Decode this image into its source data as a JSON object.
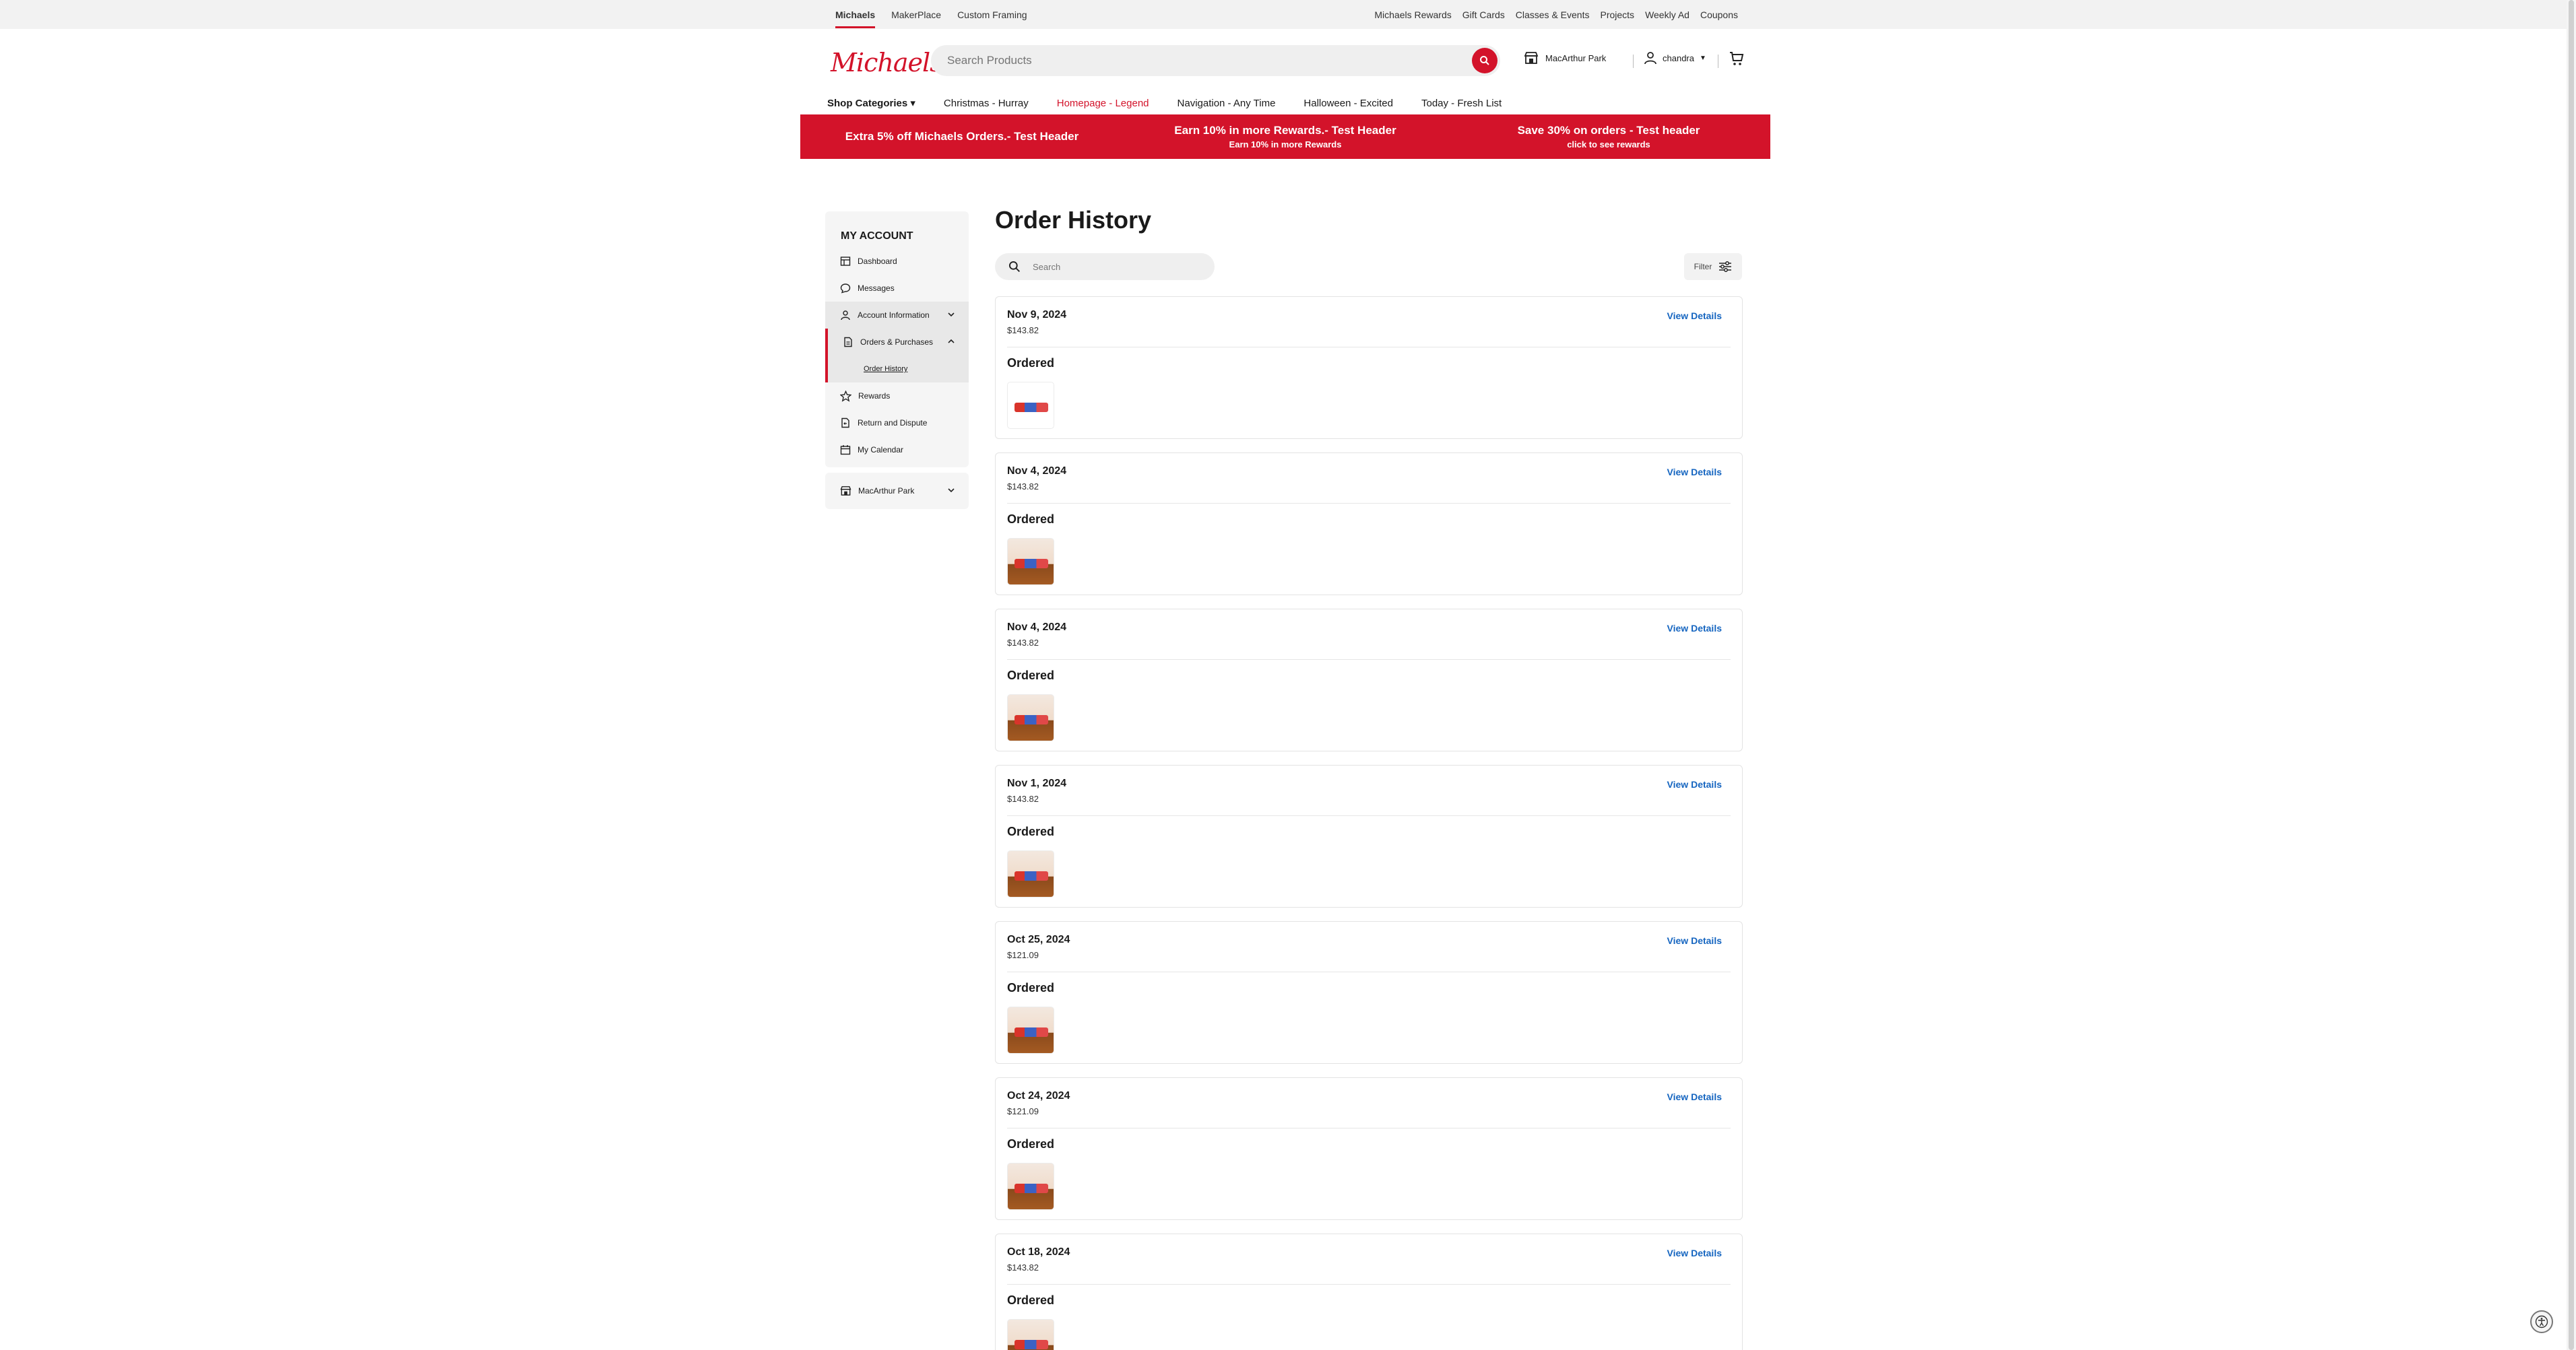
{
  "utility_bar": {
    "left": [
      "Michaels",
      "MakerPlace",
      "Custom Framing"
    ],
    "right": [
      "Michaels Rewards",
      "Gift Cards",
      "Classes & Events",
      "Projects",
      "Weekly Ad",
      "Coupons"
    ]
  },
  "header": {
    "logo": "Michaels",
    "search_placeholder": "Search Products",
    "store": "MacArthur Park",
    "user": "chandra"
  },
  "nav": [
    "Shop Categories",
    "Christmas - Hurray",
    "Homepage - Legend",
    "Navigation - Any Time",
    "Halloween - Excited",
    "Today - Fresh List"
  ],
  "promos": [
    {
      "main": "Extra 5% off Michaels Orders.- Test Header",
      "sub": ""
    },
    {
      "main": "Earn 10% in more Rewards.- Test Header",
      "sub": "Earn 10% in more Rewards"
    },
    {
      "main": "Save 30% on orders - Test header",
      "sub": "click to see rewards"
    }
  ],
  "sidebar": {
    "heading": "MY ACCOUNT",
    "items": [
      "Dashboard",
      "Messages",
      "Account Information",
      "Orders & Purchases",
      "Order History",
      "Rewards",
      "Return and Dispute",
      "My Calendar"
    ],
    "store": "MacArthur Park"
  },
  "main": {
    "title": "Order History",
    "search_placeholder": "Search",
    "filter_label": "Filter",
    "view_details_label": "View Details",
    "orders": [
      {
        "date": "Nov 9, 2024",
        "total": "$143.82",
        "status": "Ordered"
      },
      {
        "date": "Nov 4, 2024",
        "total": "$143.82",
        "status": "Ordered"
      },
      {
        "date": "Nov 4, 2024",
        "total": "$143.82",
        "status": "Ordered"
      },
      {
        "date": "Nov 1, 2024",
        "total": "$143.82",
        "status": "Ordered"
      },
      {
        "date": "Oct 25, 2024",
        "total": "$121.09",
        "status": "Ordered"
      },
      {
        "date": "Oct 24, 2024",
        "total": "$121.09",
        "status": "Ordered"
      },
      {
        "date": "Oct 18, 2024",
        "total": "$143.82",
        "status": "Ordered"
      }
    ]
  },
  "colors": {
    "brand_red": "#d3132a",
    "link_blue": "#1565c0"
  },
  "icons": [
    "search-icon",
    "store-icon",
    "user-icon",
    "cart-icon",
    "dashboard-icon",
    "messages-icon",
    "user-icon",
    "document-icon",
    "star-icon",
    "return-icon",
    "calendar-icon",
    "filter-icon",
    "accessibility-icon"
  ]
}
